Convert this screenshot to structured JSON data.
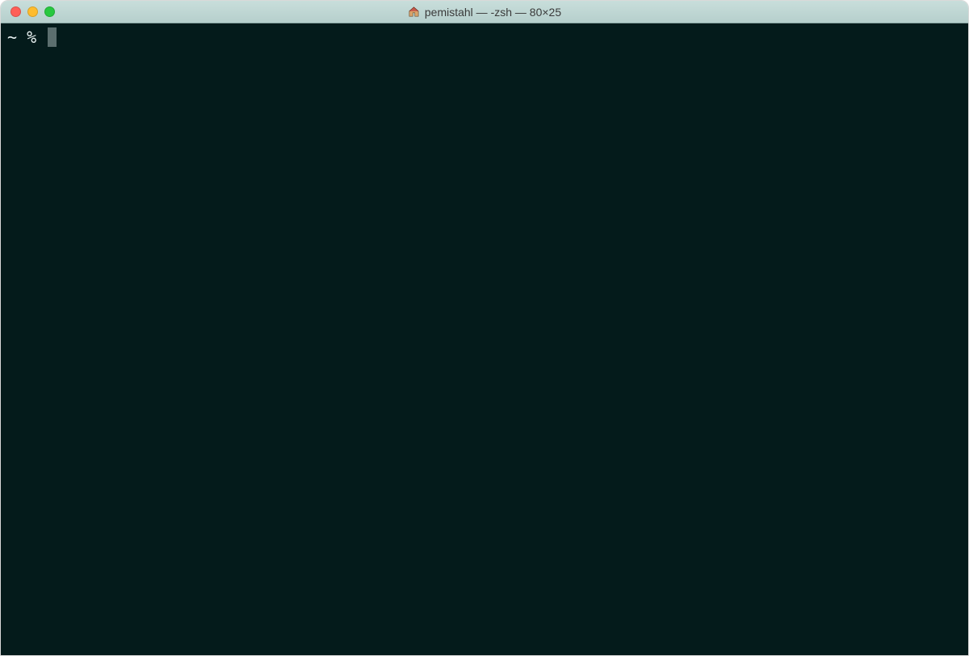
{
  "titlebar": {
    "icon_name": "home-icon",
    "title": "pemistahl — -zsh — 80×25"
  },
  "terminal": {
    "prompt": "~ % ",
    "input": "",
    "colors": {
      "background": "#041b1b",
      "foreground": "#e8f1f1",
      "cursor": "#5b6e6e"
    }
  }
}
